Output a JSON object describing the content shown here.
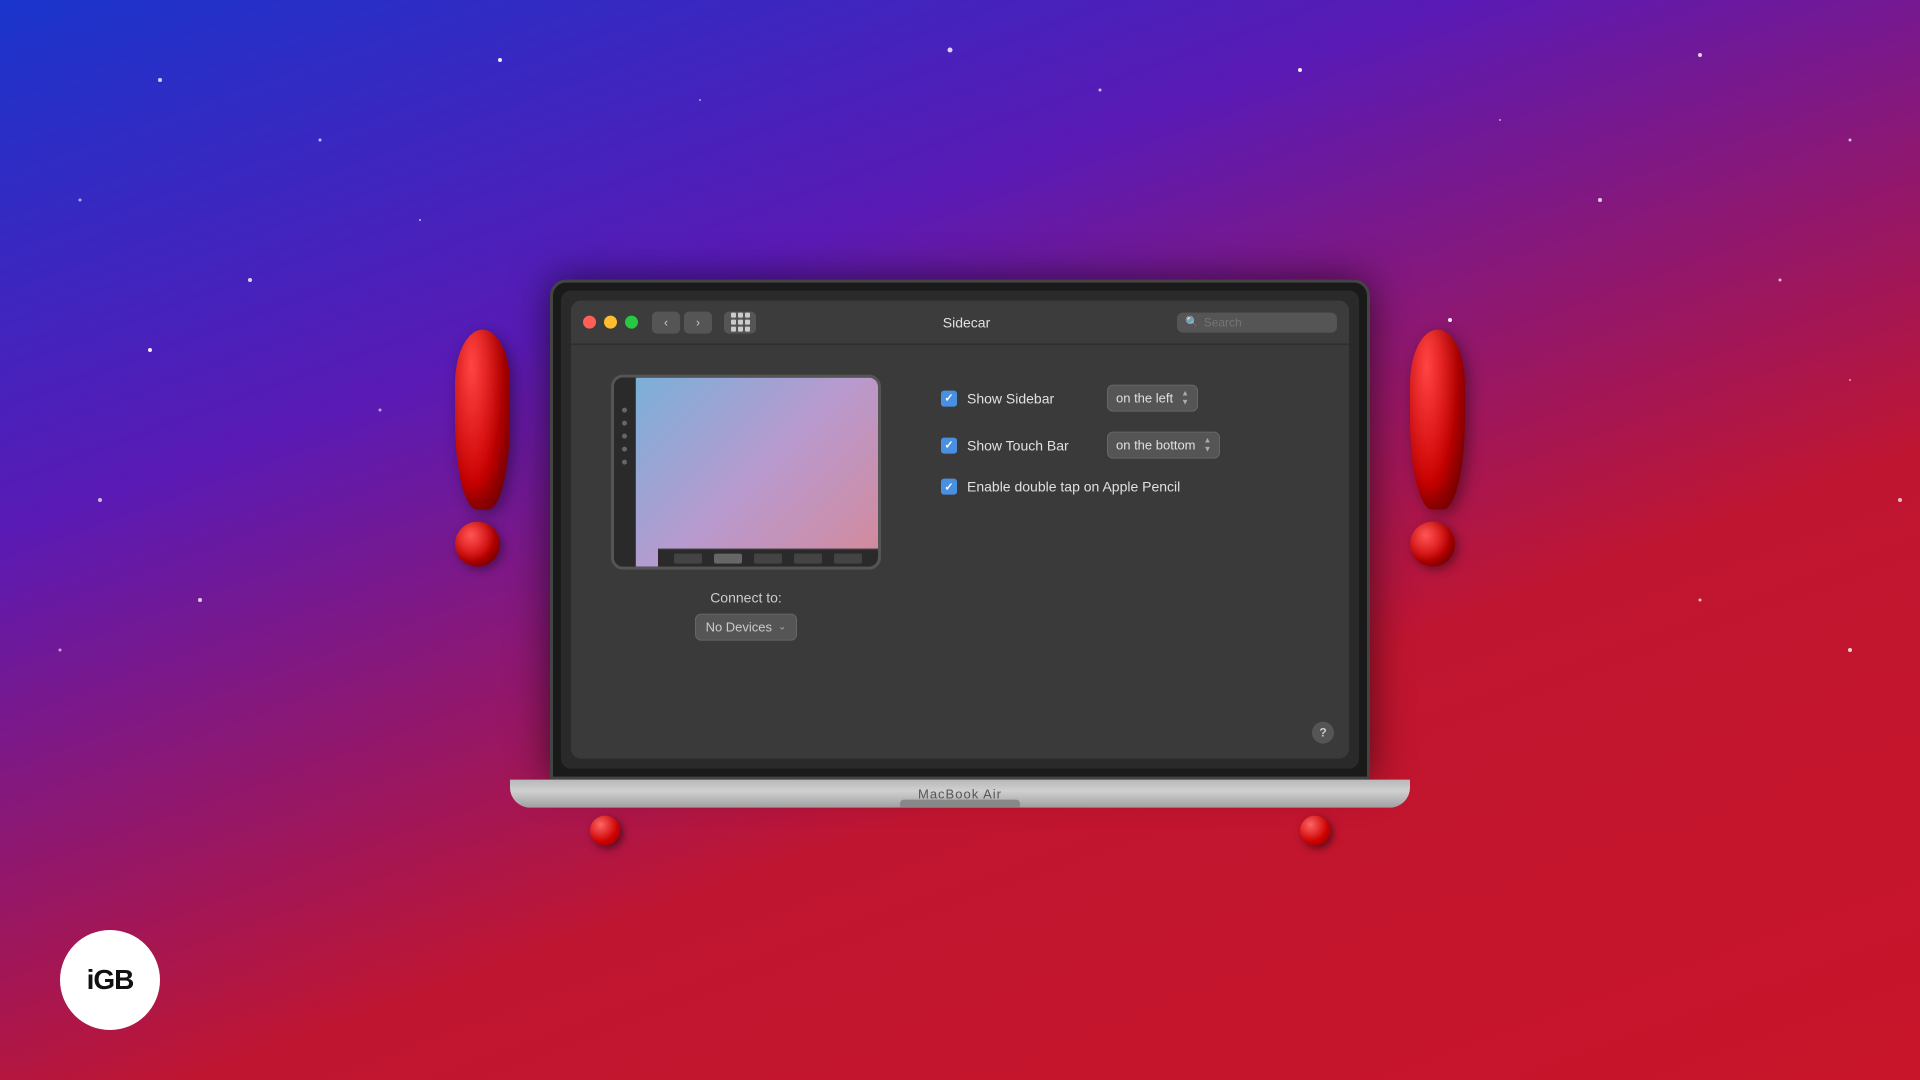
{
  "background": {
    "gradient_desc": "blue-purple-red radial gradient"
  },
  "window": {
    "title": "Sidecar",
    "search_placeholder": "Search"
  },
  "titlebar": {
    "back_label": "‹",
    "forward_label": "›"
  },
  "ipad": {
    "connect_label": "Connect to:",
    "no_devices": "No Devices"
  },
  "settings": {
    "show_sidebar_label": "Show Sidebar",
    "show_sidebar_value": "on the left",
    "show_touchbar_label": "Show Touch Bar",
    "show_touchbar_value": "on the bottom",
    "apple_pencil_label": "Enable double tap on Apple Pencil"
  },
  "macbook": {
    "label": "MacBook Air"
  },
  "logo": {
    "text": "iGB"
  }
}
